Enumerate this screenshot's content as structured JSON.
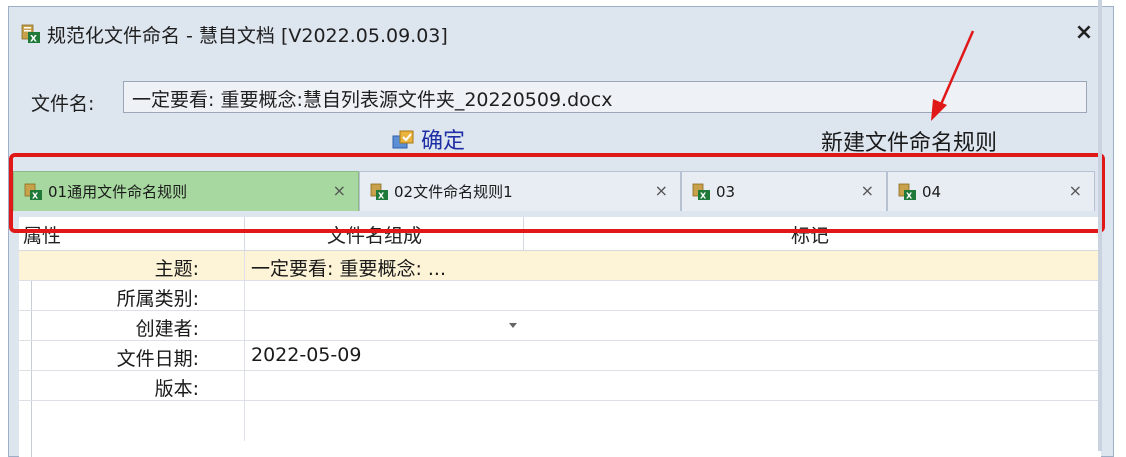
{
  "window": {
    "title": "规范化文件命名 - 慧自文档 [V2022.05.09.03]",
    "close_glyph": "×"
  },
  "filename": {
    "label": "文件名:",
    "value": "一定要看:  重要概念:慧自列表源文件夹_20220509.docx"
  },
  "actions": {
    "confirm_label": "确定",
    "new_rule_label": "新建文件命名规则"
  },
  "tabs": [
    {
      "label": "01通用文件命名规则",
      "close": "×",
      "active": true
    },
    {
      "label": "02文件命名规则1",
      "close": "×",
      "active": false
    },
    {
      "label": "03",
      "close": "×",
      "active": false
    },
    {
      "label": "04",
      "close": "×",
      "active": false
    }
  ],
  "grid": {
    "columns": [
      "属性",
      "文件名组成",
      "标记"
    ],
    "rows": [
      {
        "label": "主题:",
        "value": "一定要看:  重要概念: ..."
      },
      {
        "label": "所属类别:",
        "value": ""
      },
      {
        "label": "创建者:",
        "value": ""
      },
      {
        "label": "文件日期:",
        "value": "2022-05-09"
      },
      {
        "label": "版本:",
        "value": ""
      }
    ]
  },
  "colors": {
    "active_tab": "#a7d8a0",
    "highlight_border": "#e01818",
    "confirm_text": "#1e2fa6",
    "selected_row": "#fdf3d6"
  },
  "icons": {
    "app": "excel-doc-icon",
    "confirm": "confirm-icon",
    "tab": "excel-doc-icon",
    "annotation": "red-arrow-icon"
  }
}
